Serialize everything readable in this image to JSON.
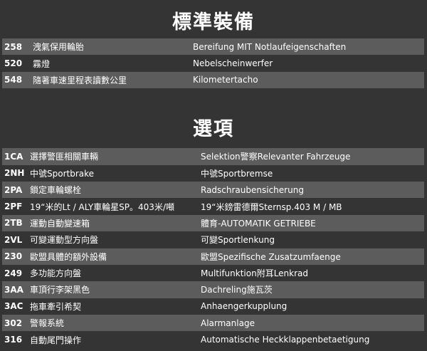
{
  "standard": {
    "title": "標準裝備",
    "rows": [
      {
        "code": "258",
        "zh": "洩氣保用輪胎",
        "de": "Bereifung MIT Notlaufeigenschaften"
      },
      {
        "code": "520",
        "zh": "霧燈",
        "de": "Nebelscheinwerfer"
      },
      {
        "code": "548",
        "zh": "隨著車速里程表讀數公里",
        "de": "Kilometertacho"
      }
    ]
  },
  "options": {
    "title": "選項",
    "rows": [
      {
        "code": "1CA",
        "zh": "選擇警匪相關車輛",
        "de": "Selektion警察Relevanter Fahrzeuge"
      },
      {
        "code": "2NH",
        "zh": "中號Sportbrake",
        "de": "中號Sportbremse"
      },
      {
        "code": "2PA",
        "zh": "鎖定車輪螺栓",
        "de": "Radschraubensicherung"
      },
      {
        "code": "2PF",
        "zh": "19“米的Lt / ALY車輪星SP。403米/噸",
        "de": "19“米鎊雷德爾Sternsp.403 M / MB"
      },
      {
        "code": "2TB",
        "zh": "運動自動變速箱",
        "de": "體育-AUTOMATIK GETRIEBE"
      },
      {
        "code": "2VL",
        "zh": "可變運動型方向盤",
        "de": "可變Sportlenkung"
      },
      {
        "code": "230",
        "zh": "歐盟具體的額外設備",
        "de": "歐盟Spezifische Zusatzumfaenge"
      },
      {
        "code": "249",
        "zh": "多功能方向盤",
        "de": "Multifunktion附耳Lenkrad"
      },
      {
        "code": "3AA",
        "zh": "車頂行李架黑色",
        "de": "Dachreling施瓦茨"
      },
      {
        "code": "3AC",
        "zh": "拖車牽引希契",
        "de": "Anhaengerkupplung"
      },
      {
        "code": "302",
        "zh": "警報系統",
        "de": "Alarmanlage"
      },
      {
        "code": "316",
        "zh": "自動尾門操作",
        "de": "Automatische Heckklappenbetaetigung"
      }
    ]
  }
}
